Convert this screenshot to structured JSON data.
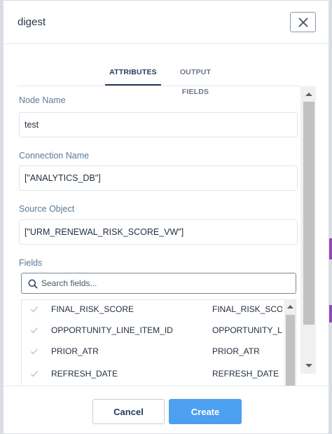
{
  "modal": {
    "title": "digest",
    "close_icon": "close-icon"
  },
  "tabs": [
    {
      "label": "ATTRIBUTES",
      "active": true
    },
    {
      "label": "OUTPUT FIELDS",
      "active": false
    }
  ],
  "form": {
    "node_name": {
      "label": "Node Name",
      "value": "test"
    },
    "connection_name": {
      "label": "Connection Name",
      "value": "[\"ANALYTICS_DB\"]"
    },
    "source_object": {
      "label": "Source Object",
      "value": "[\"URM_RENEWAL_RISK_SCORE_VW\"]"
    },
    "fields": {
      "label": "Fields",
      "search_placeholder": "Search fields...",
      "rows": [
        {
          "name": "FINAL_RISK_SCORE",
          "alias": "FINAL_RISK_SCORE"
        },
        {
          "name": "OPPORTUNITY_LINE_ITEM_ID",
          "alias": "OPPORTUNITY_LINE_ITEM_ID"
        },
        {
          "name": "PRIOR_ATR",
          "alias": "PRIOR_ATR"
        },
        {
          "name": "REFRESH_DATE",
          "alias": "REFRESH_DATE"
        }
      ]
    }
  },
  "footer": {
    "cancel_label": "Cancel",
    "create_label": "Create"
  },
  "colors": {
    "accent": "#4d9ff0",
    "tab_active": "#1f3b5c",
    "label": "#5b7a9a"
  }
}
